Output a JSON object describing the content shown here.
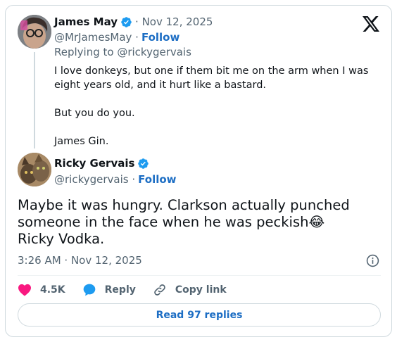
{
  "parent_tweet": {
    "author_name": "James May",
    "date": "· Nov 12, 2025",
    "handle": "@MrJamesMay ·",
    "follow_label": "Follow",
    "replying_to": "Replying to @rickygervais",
    "lines": [
      "I love donkeys, but one if them bit me on the arm when I was eight years old, and it hurt like a bastard.",
      "But you do you.",
      "James Gin."
    ]
  },
  "main_tweet": {
    "author_name": "Ricky Gervais",
    "handle": "@rickygervais ·",
    "follow_label": "Follow",
    "lines": [
      "Maybe it was hungry. Clarkson actually punched someone in the face when he was peckish😂",
      "Ricky Vodka."
    ],
    "timestamp": "3:26 AM · Nov 12, 2025"
  },
  "actions": {
    "like_count": "4.5K",
    "reply_label": "Reply",
    "copy_link_label": "Copy link"
  },
  "read_replies_label": "Read 97 replies",
  "colors": {
    "text": "#0f1419",
    "muted": "#536471",
    "link": "#1d6ec4",
    "verified": "#1d9bf0",
    "like": "#f91880",
    "border": "#cfd9de"
  },
  "icons": [
    "x-logo-icon",
    "verified-badge-icon",
    "info-icon",
    "heart-icon",
    "reply-bubble-icon",
    "link-icon"
  ]
}
